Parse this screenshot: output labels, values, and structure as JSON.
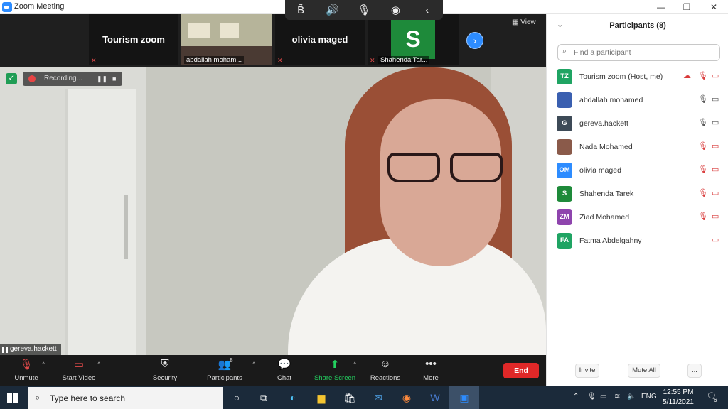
{
  "window": {
    "title": "Zoom Meeting",
    "minimize": "—",
    "restore": "❐",
    "close": "✕"
  },
  "floating_toolbar": {
    "items": [
      "B͂",
      "🔊",
      "🎙",
      "◉",
      "‹"
    ]
  },
  "thumbnails": [
    {
      "label": "Tourism zoom"
    },
    {
      "label": "abdallah moham..."
    },
    {
      "label": "olivia maged"
    },
    {
      "label": "Shahenda Tar...",
      "avatar_letter": "S"
    }
  ],
  "view_label": "View",
  "next_arrow": "›",
  "recording": {
    "label": "Recording...",
    "pause": "❚❚",
    "stop": "■"
  },
  "active_speaker": "gereva.hackett",
  "toolbar": {
    "unmute": "Unmute",
    "start_video": "Start Video",
    "security": "Security",
    "participants": "Participants",
    "participants_count": "8",
    "chat": "Chat",
    "share_screen": "Share Screen",
    "reactions": "Reactions",
    "more": "More",
    "end": "End",
    "caret": "^"
  },
  "panel": {
    "title": "Participants (8)",
    "search_placeholder": "Find a participant",
    "participants": [
      {
        "initials": "TZ",
        "name": "Tourism zoom (Host, me)",
        "color": "#1fa463"
      },
      {
        "initials": "",
        "name": "abdallah mohamed",
        "color": "#3a5fb0"
      },
      {
        "initials": "G",
        "name": "gereva.hackett",
        "color": "#3d4a57"
      },
      {
        "initials": "",
        "name": "Nada Mohamed",
        "color": "#8a5a4a"
      },
      {
        "initials": "OM",
        "name": "olivia maged",
        "color": "#2d8cff"
      },
      {
        "initials": "S",
        "name": "Shahenda Tarek",
        "color": "#1e8a3a"
      },
      {
        "initials": "ZM",
        "name": "Ziad Mohamed",
        "color": "#8e44ad"
      },
      {
        "initials": "FA",
        "name": "Fatma Abdelgahny",
        "color": "#1fa463"
      }
    ],
    "invite": "Invite",
    "mute_all": "Mute All",
    "more": "..."
  },
  "taskbar": {
    "search_placeholder": "Type here to search",
    "lang": "ENG",
    "time": "12:55 PM",
    "date": "5/11/2021",
    "notifications": "6"
  }
}
